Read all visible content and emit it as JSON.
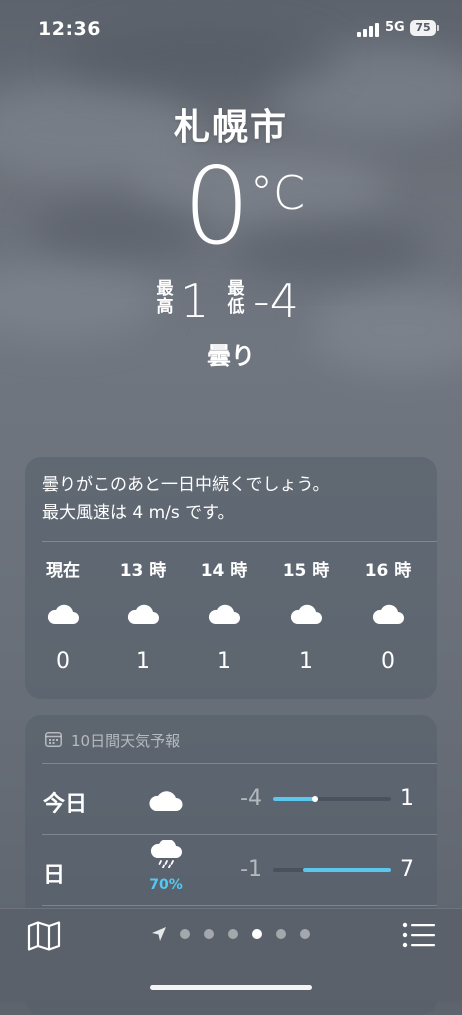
{
  "status_bar": {
    "time": "12:36",
    "network": "5G",
    "battery": "75"
  },
  "location": {
    "city": "札幌市",
    "temperature": "0",
    "unit": "°C",
    "high_label": "最高",
    "high": "1",
    "low_label": "最低",
    "low": "-4",
    "condition": "曇り"
  },
  "hourly": {
    "summary_line1": "曇りがこのあと一日中続くでしょう。",
    "summary_line2": "最大風速は 4 m/s です。",
    "items": [
      {
        "time": "現在",
        "icon": "cloud-icon",
        "temp": "0"
      },
      {
        "time": "13 時",
        "icon": "cloud-icon",
        "temp": "1"
      },
      {
        "time": "14 時",
        "icon": "cloud-icon",
        "temp": "1"
      },
      {
        "time": "15 時",
        "icon": "cloud-icon",
        "temp": "1"
      },
      {
        "time": "16 時",
        "icon": "cloud-icon",
        "temp": "0"
      }
    ]
  },
  "daily": {
    "header": "10日間天気予報",
    "days": [
      {
        "name": "今日",
        "icon": "cloud-icon",
        "low": "-4",
        "high": "1",
        "range_start": 0.0,
        "range_end": 0.38,
        "current_marker": 0.36
      },
      {
        "name": "日",
        "icon": "cloud-rain-icon",
        "precip": "70%",
        "low": "-1",
        "high": "7",
        "range_start": 0.25,
        "range_end": 1.0
      }
    ]
  },
  "bottom_bar": {
    "page_count": 6,
    "active_page": 3
  },
  "colors": {
    "accent_blue": "#5bc6ee",
    "precip_blue": "#55c8f2",
    "background": "#6b7079"
  }
}
